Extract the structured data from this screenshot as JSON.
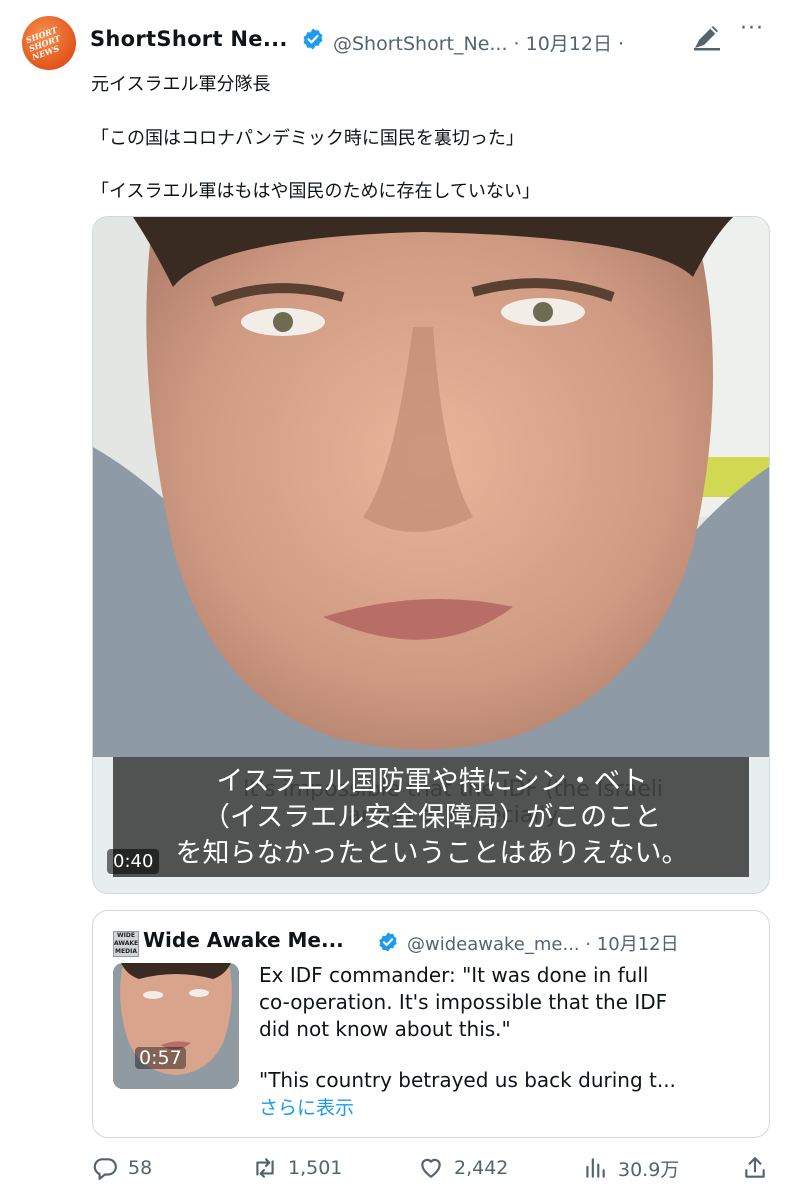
{
  "header": {
    "author_name": "ShortShort Ne...",
    "handle_date": "@ShortShort_Ne... · 10月12日 ·",
    "avatar_text": "SHORT SHORT NEWS",
    "more_label": "···"
  },
  "tweet": {
    "lines": [
      "元イスラエル軍分隊長",
      "「この国はコロナパンデミック時に国民を裏切った」",
      "「イスラエル軍はもはや国民のために存在していない」"
    ]
  },
  "video": {
    "subtitle_en": "It's impossible that the IDF (the Israeli army) or especially",
    "subtitle_jp": [
      "イスラエル国防軍や特にシン・ベト",
      "（イスラエル安全保障局）がこのこと",
      "を知らなかったということはありえない。"
    ],
    "time": "0:40"
  },
  "quote": {
    "avatar_text": "WIDE AWAKE MEDIA",
    "name": "Wide Awake Me...",
    "handle_date": "@wideawake_me... · 10月12日",
    "thumb_time": "0:57",
    "text_lines": [
      "Ex IDF commander: \"It was done in full",
      "co-operation. It's impossible that the IDF",
      "did not know about this.\"",
      "\"This country betrayed us back during t..."
    ],
    "show_more": "さらに表示"
  },
  "actions": {
    "replies": "58",
    "retweets": "1,501",
    "likes": "2,442",
    "views": "30.9万"
  },
  "colors": {
    "verified": "#1d9bf0",
    "muted": "#536471",
    "accent_avatar": "#e2551c"
  }
}
